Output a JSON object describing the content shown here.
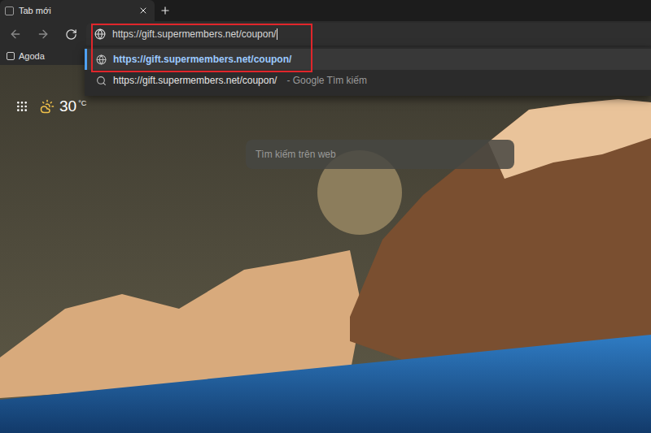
{
  "tabs": [
    {
      "label": "Tab mới",
      "selected": true
    }
  ],
  "address_bar": {
    "value": "https://gift.supermembers.net/coupon/",
    "focused": true
  },
  "suggestions": [
    {
      "kind": "url",
      "text": "https://gift.supermembers.net/coupon/",
      "suffix": "",
      "selected": true
    },
    {
      "kind": "search",
      "text": "https://gift.supermembers.net/coupon/",
      "suffix": "- Google Tìm kiếm",
      "selected": false
    }
  ],
  "favorites": [
    {
      "label": "Agoda"
    }
  ],
  "weather": {
    "temperature": "30",
    "unit": "°C"
  },
  "search": {
    "placeholder": "Tìm kiếm trên web"
  }
}
